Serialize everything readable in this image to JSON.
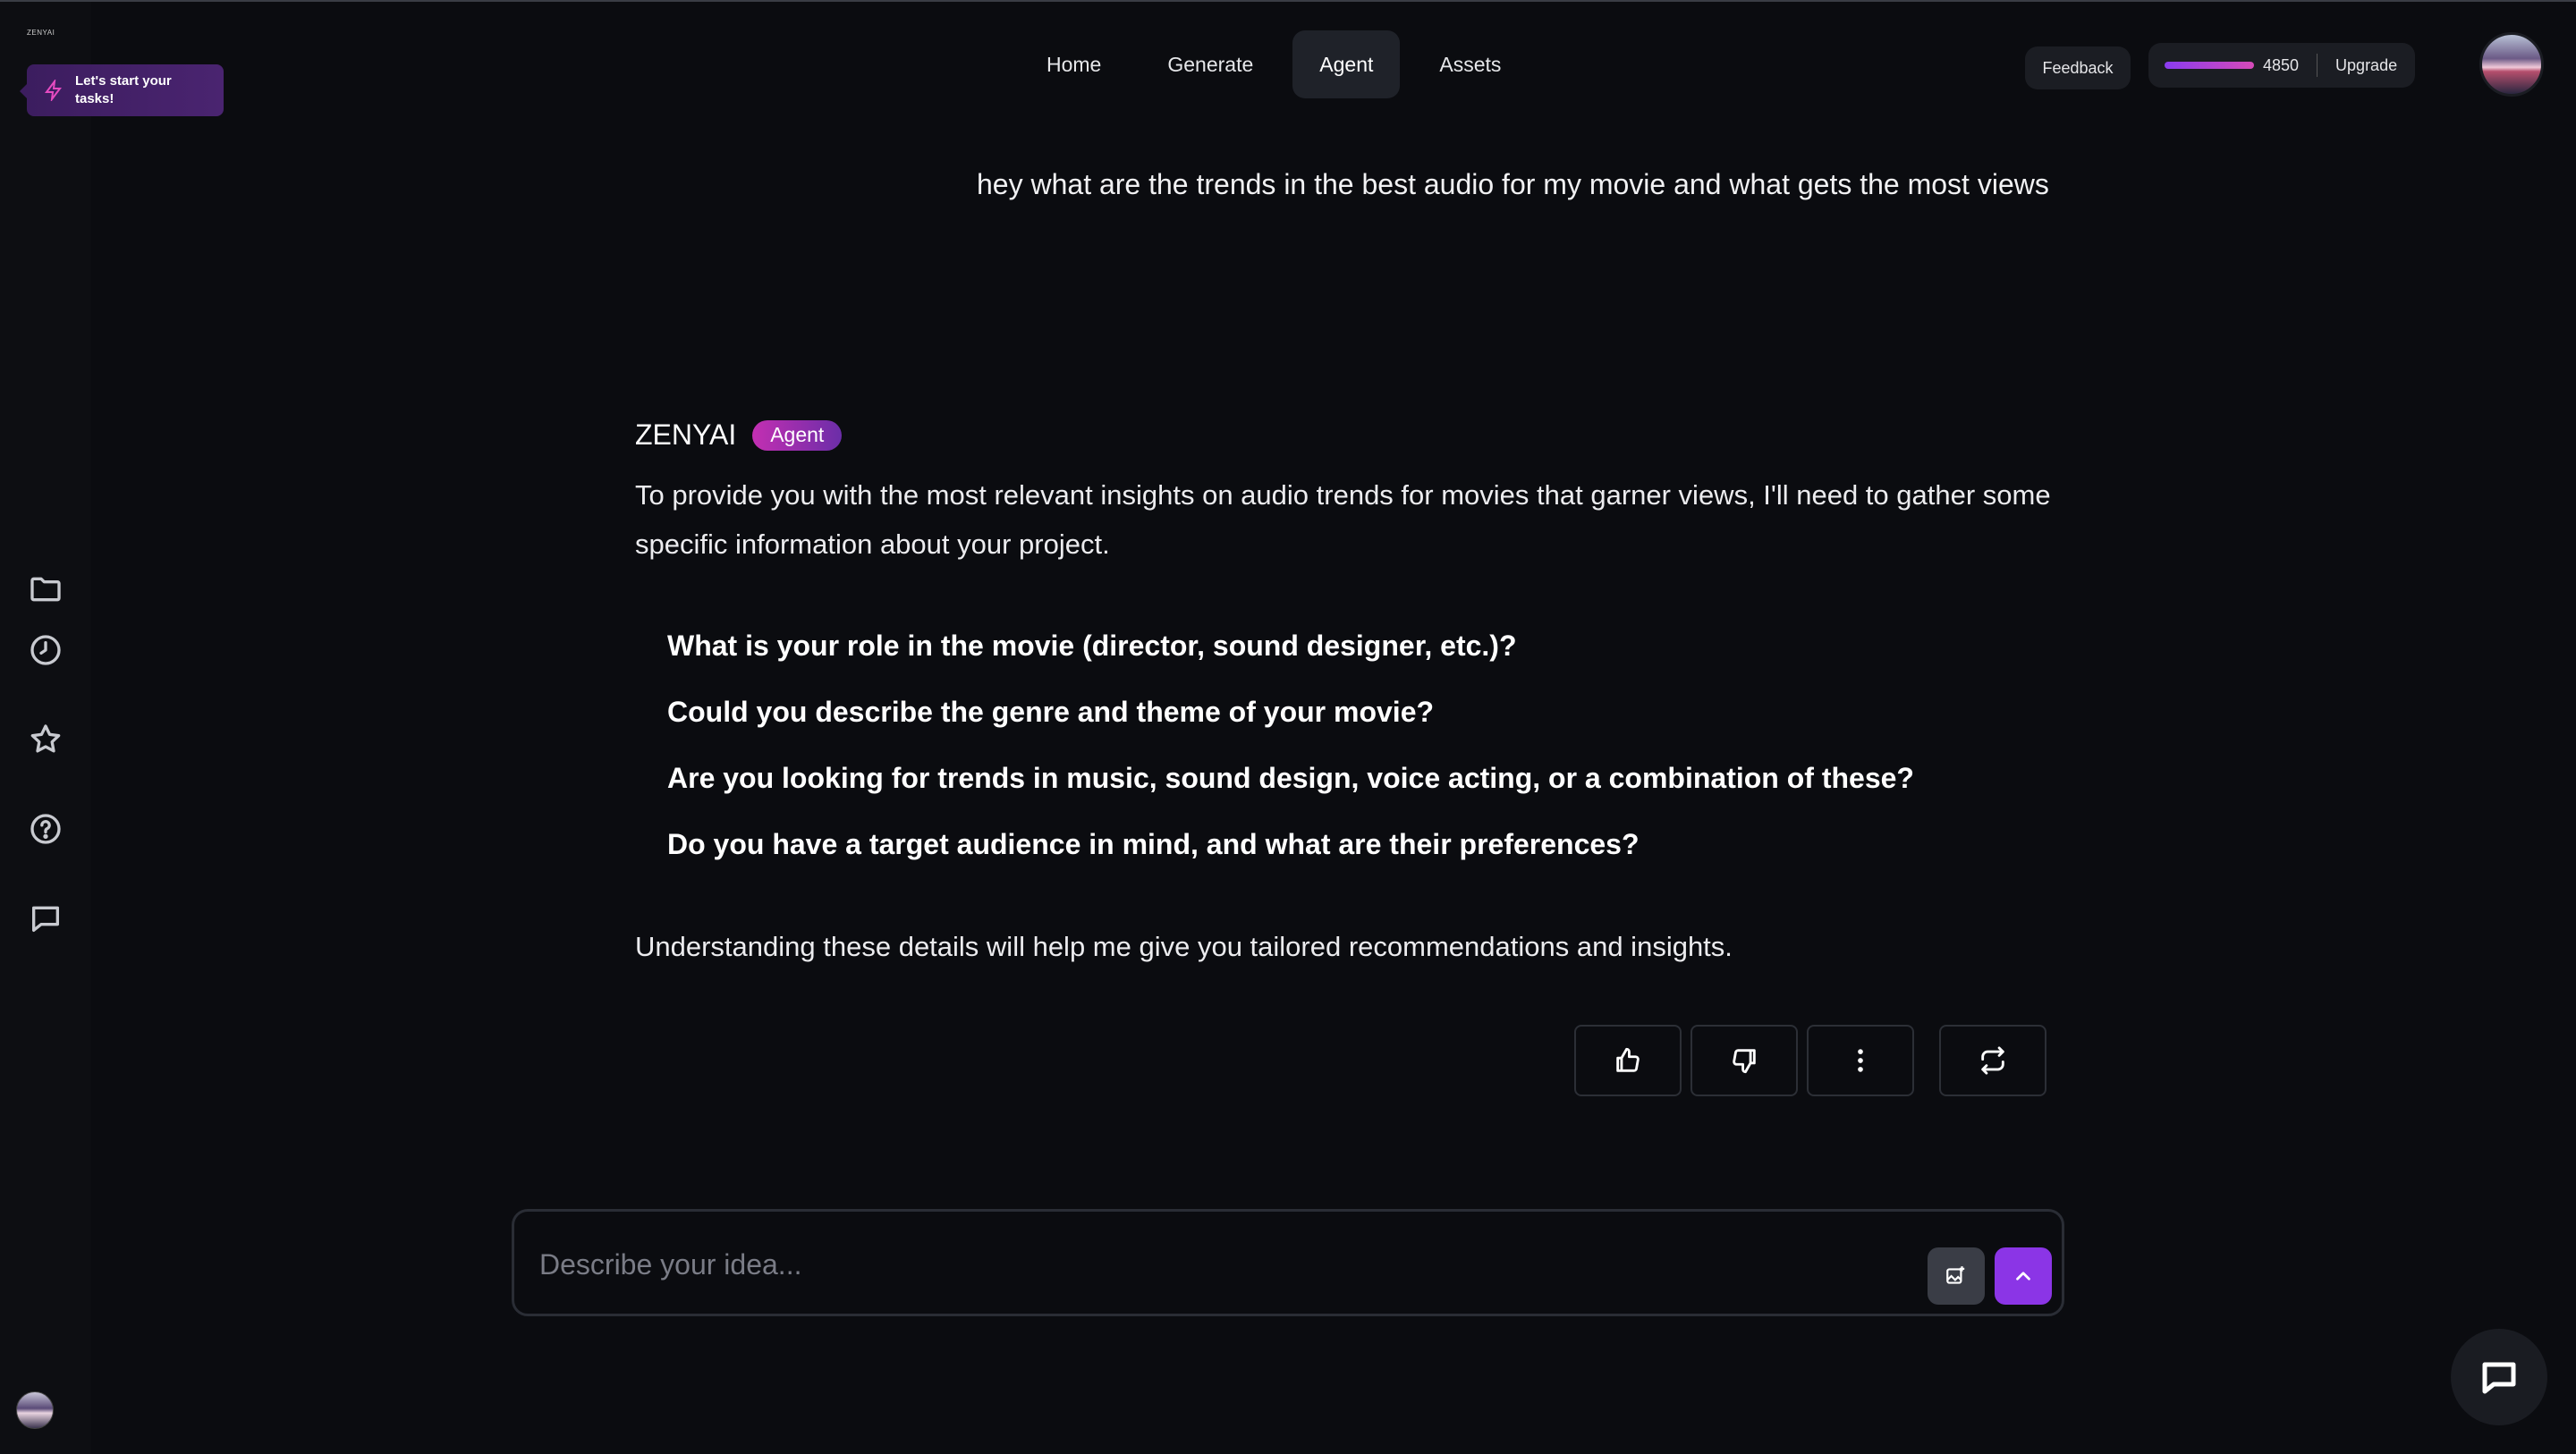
{
  "app": {
    "logo_text": "ZENYAI"
  },
  "sidebar": {
    "task_prompt": "Let's start your tasks!",
    "icons": [
      "folder-icon",
      "clock-icon",
      "star-icon",
      "help-icon",
      "message-icon"
    ]
  },
  "nav": {
    "items": [
      {
        "label": "Home",
        "active": false
      },
      {
        "label": "Generate",
        "active": false
      },
      {
        "label": "Agent",
        "active": true
      },
      {
        "label": "Assets",
        "active": false
      }
    ]
  },
  "header": {
    "feedback_label": "Feedback",
    "credits": "4850",
    "credits_fill_fraction": 0.95,
    "upgrade_label": "Upgrade"
  },
  "chat": {
    "user_message": "hey what are the trends in the best audio for my movie and what gets the most views",
    "agent_name": "ZENYAI",
    "agent_badge": "Agent",
    "agent_intro": "To provide you with the most relevant insights on audio trends for movies that garner views, I'll need to gather some specific information about your project.",
    "questions": [
      "What is your role in the movie (director, sound designer, etc.)?",
      "Could you describe the genre and theme of your movie?",
      "Are you looking for trends in music, sound design, voice acting, or a combination of these?",
      "Do you have a target audience in mind, and what are their preferences?"
    ],
    "agent_outro": "Understanding these details will help me give you tailored recommendations and insights."
  },
  "composer": {
    "placeholder": "Describe your idea...",
    "value": ""
  },
  "colors": {
    "background": "#0b0c10",
    "accent": "#8b35e6",
    "badge_start": "#c32fb2",
    "badge_end": "#6b2ea8"
  }
}
